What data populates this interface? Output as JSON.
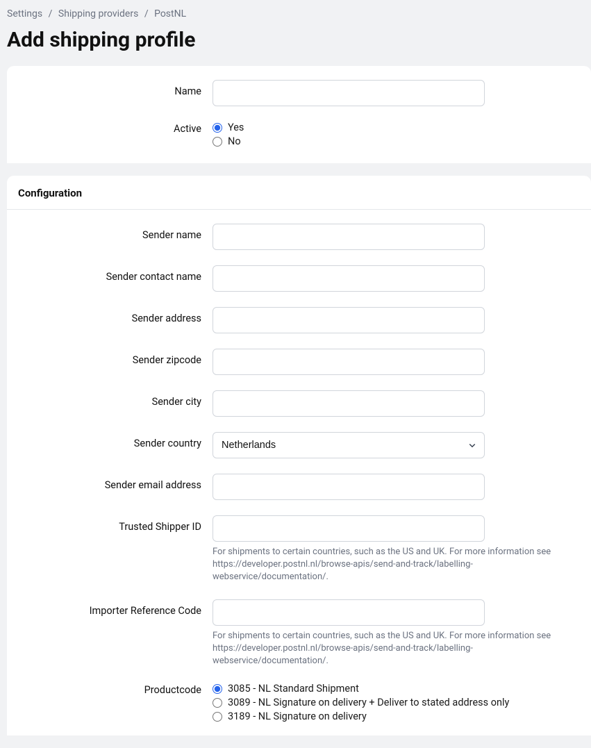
{
  "breadcrumb": {
    "items": [
      "Settings",
      "Shipping providers",
      "PostNL"
    ]
  },
  "page_title": "Add shipping profile",
  "panel1": {
    "name_label": "Name",
    "name_value": "",
    "active_label": "Active",
    "active_options": {
      "yes": "Yes",
      "no": "No"
    },
    "active_selected": "yes"
  },
  "panel2": {
    "title": "Configuration",
    "sender_name_label": "Sender name",
    "sender_name_value": "",
    "sender_contact_name_label": "Sender contact name",
    "sender_contact_name_value": "",
    "sender_address_label": "Sender address",
    "sender_address_value": "",
    "sender_zipcode_label": "Sender zipcode",
    "sender_zipcode_value": "",
    "sender_city_label": "Sender city",
    "sender_city_value": "",
    "sender_country_label": "Sender country",
    "sender_country_value": "Netherlands",
    "sender_email_label": "Sender email address",
    "sender_email_value": "",
    "trusted_shipper_label": "Trusted Shipper ID",
    "trusted_shipper_value": "",
    "trusted_shipper_help": "For shipments to certain countries, such as the US and UK. For more information see https://developer.postnl.nl/browse-apis/send-and-track/labelling-webservice/documentation/.",
    "importer_ref_label": "Importer Reference Code",
    "importer_ref_value": "",
    "importer_ref_help": "For shipments to certain countries, such as the US and UK. For more information see https://developer.postnl.nl/browse-apis/send-and-track/labelling-webservice/documentation/.",
    "productcode_label": "Productcode",
    "productcode_options": [
      "3085 - NL Standard Shipment",
      "3089 - NL Signature on delivery + Deliver to stated address only",
      "3189 - NL Signature on delivery"
    ],
    "productcode_selected": 0
  }
}
